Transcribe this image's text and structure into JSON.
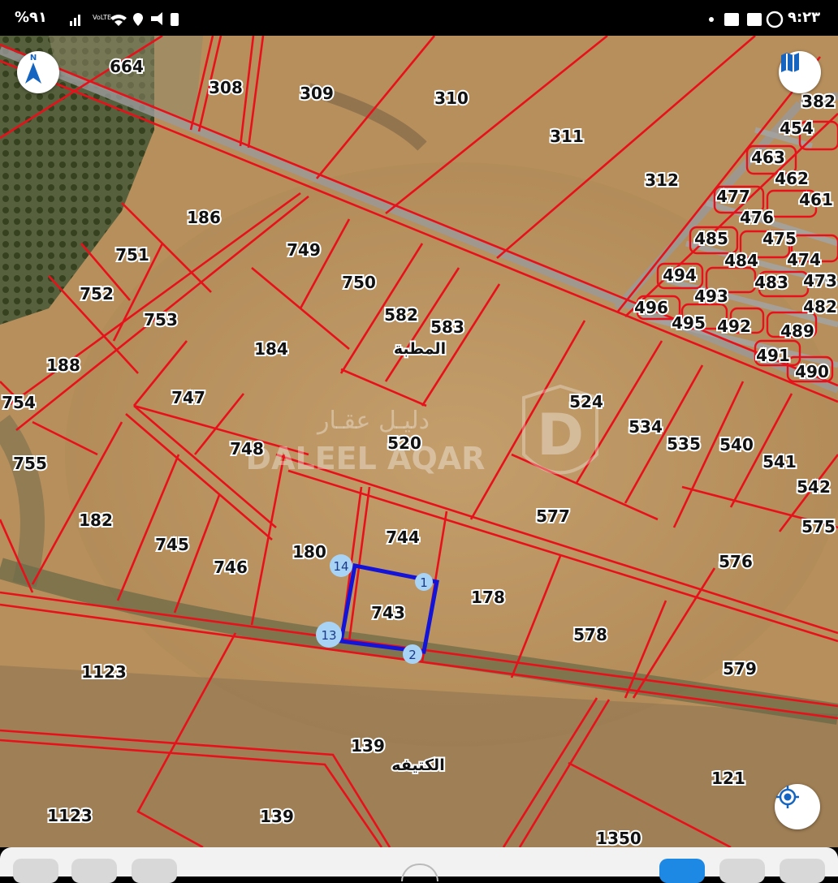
{
  "status_bar": {
    "battery": "%٩١",
    "time": "٩:٢٣",
    "left_icons": [
      "battery-icon",
      "signal-icon",
      "volte-icon",
      "wifi-icon",
      "location-icon",
      "mute-icon",
      "clipboard-icon"
    ],
    "right_icons": [
      "dot-icon",
      "notification-icon",
      "gallery-icon",
      "whatsapp-icon"
    ]
  },
  "map": {
    "watermark_arabic": "دليـل عقـار",
    "watermark_latin": "DALEEL AQAR",
    "place_names": [
      "المطبة",
      "الكتيفه"
    ],
    "parcels": [
      "664",
      "308",
      "309",
      "310",
      "311",
      "312",
      "382",
      "454",
      "463",
      "462",
      "461",
      "477",
      "476",
      "475",
      "485",
      "484",
      "474",
      "494",
      "483",
      "473",
      "493",
      "496",
      "495",
      "492",
      "482",
      "489",
      "491",
      "490",
      "186",
      "751",
      "752",
      "753",
      "749",
      "750",
      "582",
      "583",
      "184",
      "188",
      "754",
      "747",
      "748",
      "520",
      "524",
      "534",
      "535",
      "540",
      "541",
      "542",
      "575",
      "755",
      "182",
      "745",
      "746",
      "180",
      "744",
      "743",
      "178",
      "577",
      "576",
      "578",
      "579",
      "1123",
      "139",
      "121",
      "1350"
    ],
    "selected_parcel": "743",
    "vertex_labels": [
      "14",
      "1",
      "13",
      "2"
    ],
    "colors": {
      "boundary": "#e8101a",
      "selection": "#1414d8",
      "vertex": "#a9d3f5",
      "road": "#8a8a8a"
    }
  },
  "controls": {
    "north_label": "N",
    "north_icon": "north-arrow-icon",
    "layers_icon": "map-layers-icon",
    "locate_icon": "crosshair-icon"
  },
  "bottom_bar": {
    "items": [
      "toolbar-button-1",
      "toolbar-button-2",
      "toolbar-button-3",
      "home-indicator",
      "toolbar-button-4",
      "toolbar-button-5",
      "toolbar-button-6"
    ]
  }
}
